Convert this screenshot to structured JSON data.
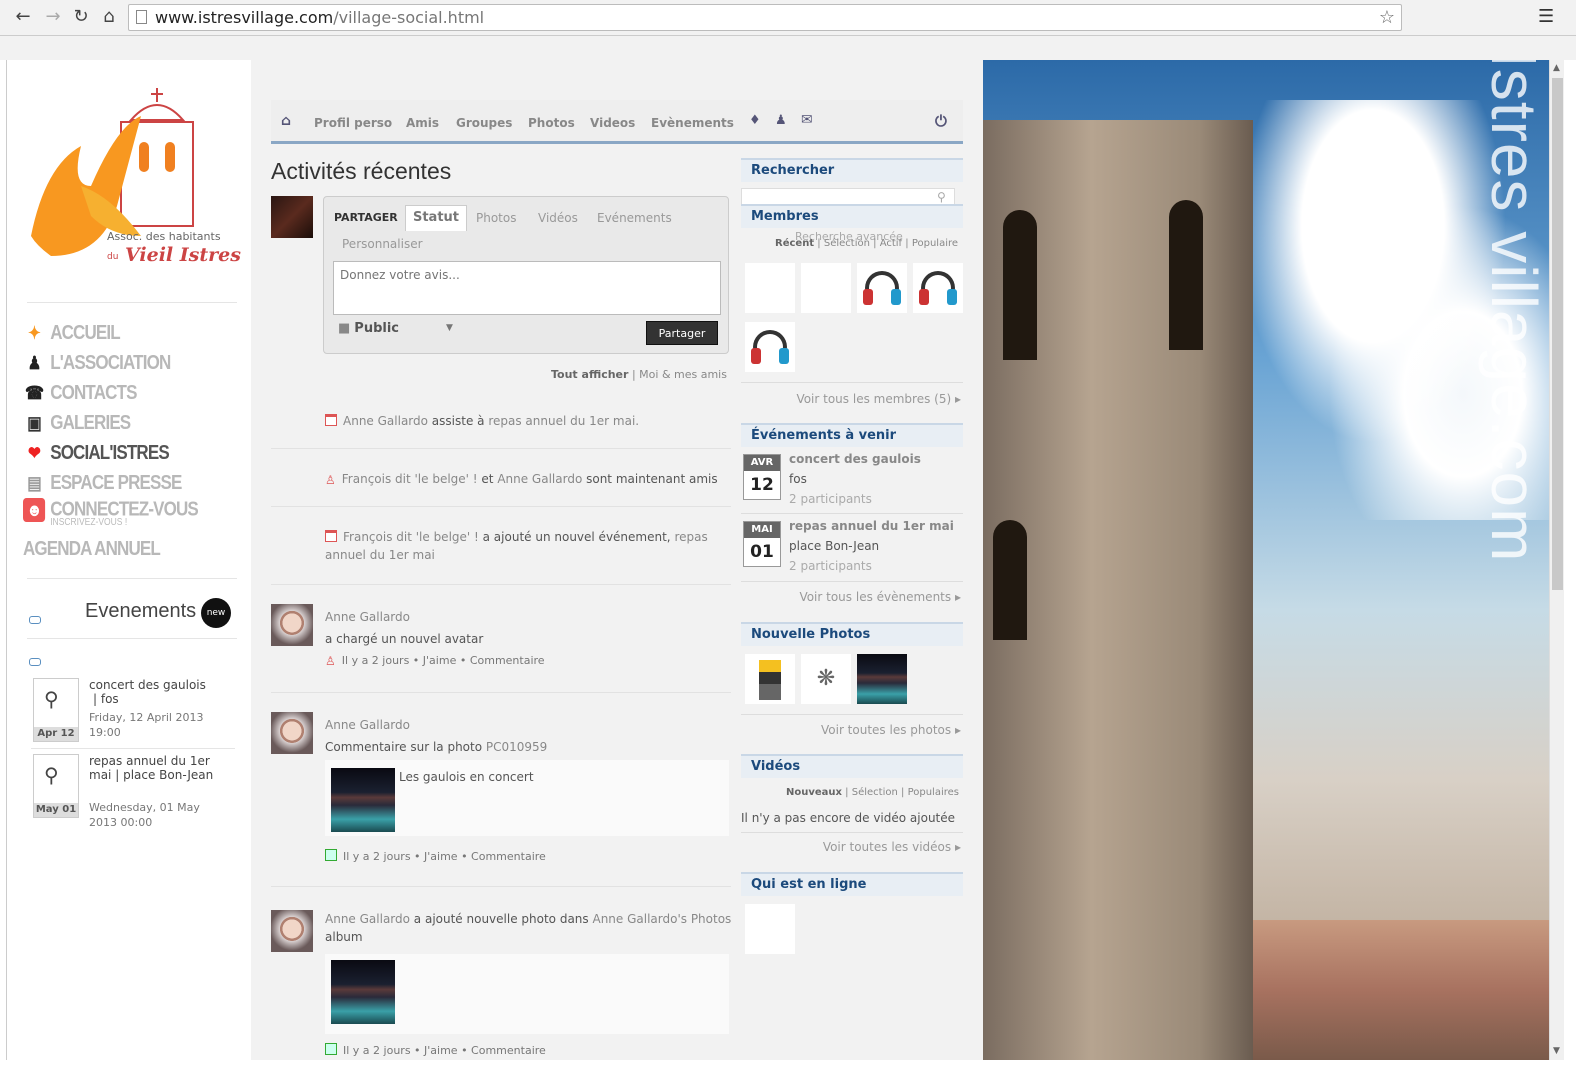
{
  "browser": {
    "url_host": "www.istresvillage.com",
    "url_path": "/village-social.html",
    "back_icon": "back-arrow-icon",
    "forward_icon": "forward-arrow-icon",
    "reload_icon": "reload-icon",
    "home_icon": "home-icon",
    "bookmark_icon": "star-icon",
    "menu_icon": "hamburger-menu-icon"
  },
  "logo": {
    "line1": "Assoc. des habitants",
    "line2": "du",
    "line3": "Vieil Istres"
  },
  "sidebar": {
    "nav": [
      {
        "label": "ACCUEIL",
        "icon": "bird-icon"
      },
      {
        "label": "L'ASSOCIATION",
        "icon": "people-icon"
      },
      {
        "label": "CONTACTS",
        "icon": "telephone-icon"
      },
      {
        "label": "GALERIES",
        "icon": "camera-icon"
      },
      {
        "label": "SOCIAL'ISTRES",
        "icon": "heart-icon"
      },
      {
        "label": "ESPACE PRESSE",
        "icon": "newspaper-icon"
      },
      {
        "label": "CONNECTEZ-VOUS",
        "sub": "INSCRIVEZ-VOUS !",
        "icon": "user-icon"
      },
      {
        "label": "AGENDA ANNUEL"
      }
    ],
    "events_title": "Evenements",
    "events_badge": "new",
    "events": [
      {
        "title": "concert des gaulois",
        "place": "|  fos",
        "date": "Friday, 12 April 2013",
        "time": "19:00",
        "badge": "Apr 12"
      },
      {
        "title": "repas annuel du 1er mai",
        "place": "|  place Bon-Jean",
        "date": "Wednesday, 01 May",
        "time": "2013 00:00",
        "badge": "May 01"
      }
    ]
  },
  "tabs": {
    "home_icon": "home-icon",
    "items": [
      "Profil perso",
      "Amis",
      "Groupes",
      "Photos",
      "Videos",
      "Evènements"
    ],
    "notifications_icon": "bell-icon",
    "friends_icon": "friends-icon",
    "messages_icon": "envelope-icon",
    "logout_icon": "power-icon"
  },
  "feed": {
    "heading": "Activités récentes",
    "share": {
      "label": "PARTAGER",
      "tabs": [
        "Statut",
        "Photos",
        "Vidéos",
        "Evénements",
        "Personnaliser"
      ],
      "placeholder": "Donnez votre avis...",
      "privacy": "Public",
      "privacy_caret": "▼",
      "button": "Partager"
    },
    "filters": {
      "all": "Tout afficher",
      "separator": "|",
      "mine": "Moi & mes amis"
    },
    "activities": {
      "a1": {
        "p1": "Anne Gallardo",
        "p2": " assiste à ",
        "p3": "repas annuel du 1er mai."
      },
      "a2": {
        "p1": "François dit 'le belge' !",
        "p2": " et ",
        "p3": "Anne Gallardo",
        "p4": " sont maintenant amis"
      },
      "a3": {
        "p1": "François dit 'le belge' !",
        "p2": " a ajouté un nouvel événement, ",
        "p3": "repas annuel du 1er mai"
      },
      "a4": {
        "author": "Anne Gallardo",
        "text": "a chargé un nouvel avatar",
        "meta": "Il y a 2 jours • J'aime • Commentaire"
      },
      "a5": {
        "author": "Anne Gallardo",
        "text": "Commentaire sur la photo ",
        "photo": "PC010959",
        "caption": "Les gaulois en concert",
        "meta": "Il y a 2 jours • J'aime • Commentaire"
      },
      "a6": {
        "author": "Anne Gallardo",
        "p2": " a ajouté nouvelle photo dans ",
        "p3": "Anne Gallardo's Photos",
        "p4": " album",
        "meta": "Il y a 2 jours • J'aime • Commentaire"
      }
    }
  },
  "right": {
    "search": {
      "title": "Rechercher",
      "advanced": "Recherche avancée",
      "icon": "search-icon"
    },
    "members": {
      "title": "Membres",
      "filters": [
        "Récent",
        "Sélection",
        "Actif",
        "Populaire"
      ],
      "sep": "|",
      "link": "Voir tous les membres (5)"
    },
    "events": {
      "title": "Événements à venir",
      "items": [
        {
          "month": "AVR",
          "day": "12",
          "title": "concert des gaulois",
          "place": "fos",
          "count": "2 participants"
        },
        {
          "month": "MAI",
          "day": "01",
          "title": "repas annuel du 1er mai",
          "place": "place Bon-Jean",
          "count": "2 participants"
        }
      ],
      "link": "Voir tous les évènements"
    },
    "photos": {
      "title": "Nouvelle Photos",
      "link": "Voir toutes les photos"
    },
    "videos": {
      "title": "Vidéos",
      "filters": [
        "Nouveaux",
        "Sélection",
        "Populaires"
      ],
      "empty": "Il n'y a pas encore de vidéo ajoutée",
      "link": "Voir toutes les vidéos"
    },
    "online": {
      "title": "Qui est en ligne"
    },
    "arrow": "▸"
  },
  "banner": {
    "watermark": "Istres village.com"
  },
  "scrollbar": {
    "up": "▲",
    "down": "▼"
  }
}
